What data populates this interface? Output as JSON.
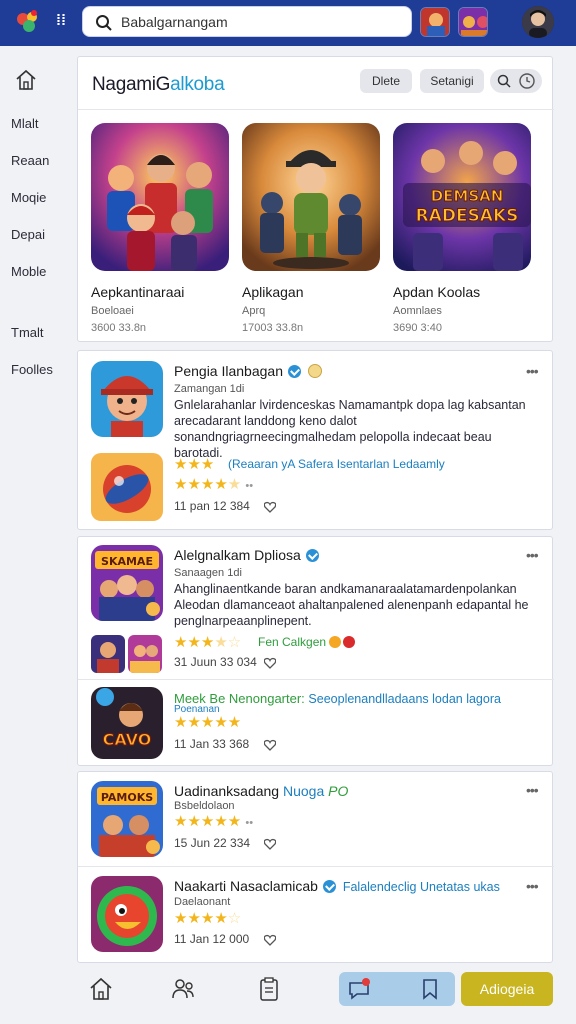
{
  "search": {
    "value": "Babalgarnangam"
  },
  "sidebar": {
    "items": [
      "Mlalt",
      "Reaan",
      "Moqie",
      "Depai",
      "Moble",
      "Tmalt",
      "Foolles"
    ]
  },
  "featured": {
    "title_main": "NagamiG",
    "title_accent": "alkoba",
    "buttons": [
      "Dlete",
      "Setanigi"
    ],
    "items": [
      {
        "name": "Aepkantinaraai",
        "sub": "Boeloaei",
        "meta": "3600 33.8n"
      },
      {
        "name": "Aplikagan",
        "sub": "Aprq",
        "meta": "17003 33.8n"
      },
      {
        "name": "Apdan Koolas",
        "sub": "Aomnlaes",
        "meta": "3690 3:40"
      }
    ],
    "game_art_text": "DEMSAN RADESAKS"
  },
  "card1": {
    "title": "Pengia Ilanbagan",
    "subtitle": "Zamangan 1di",
    "desc": "Gnlelarahanlar lvirdenceskas Namamantpk dopa lag kabsantan arecadarant landdong keno dalot sonandngriagrneecingmalhedam pelopolla indecaat beau barotadi.",
    "review": "(Reaaran yA Safera Isentarlan Ledaamly",
    "date": "11 pan 12 384"
  },
  "card2": {
    "title": "Alelgnalkam Dpliosa",
    "subtitle": "Sanaagen 1di",
    "desc": "Ahanglinaentkande baran andkamanaraalatamardenpolankan Aleodan dlamanceaot ahaltanpalened alenenpanh edapantal he penglnarpeaanplinepent.",
    "review": "Fen Calkgen",
    "date": "31 Juun 33 034",
    "game_art_text": "SKAMAE",
    "sub_title": "Meek Be Nenongarter:",
    "sub_review": "Seeoplenandlladaans lodan lagora",
    "sub_label": "Poenanan",
    "sub_date": "11 Jan 33 368",
    "sub_art_text": "CAVO"
  },
  "card3": {
    "item1": {
      "title": "Uadinanksadang",
      "accent": "Nuoga",
      "accent2": "PO",
      "subtitle": "Bsbeldolaon",
      "date": "15 Jun 22 334",
      "art_text": "PAMOKS"
    },
    "item2": {
      "title": "Naakarti Nasaclamicab",
      "review": "Falalendeclig Unetatas ukas",
      "subtitle": "Daelaonant",
      "date": "11 Jan 12 000"
    }
  },
  "bottom": {
    "primary_label": "Adiogeia"
  },
  "colors": {
    "topbar": "#1f3c97",
    "accent": "#1c9bd1",
    "star": "#f3b51c",
    "primary_button": "#c8b520",
    "secondary_button": "#a9cde8"
  }
}
